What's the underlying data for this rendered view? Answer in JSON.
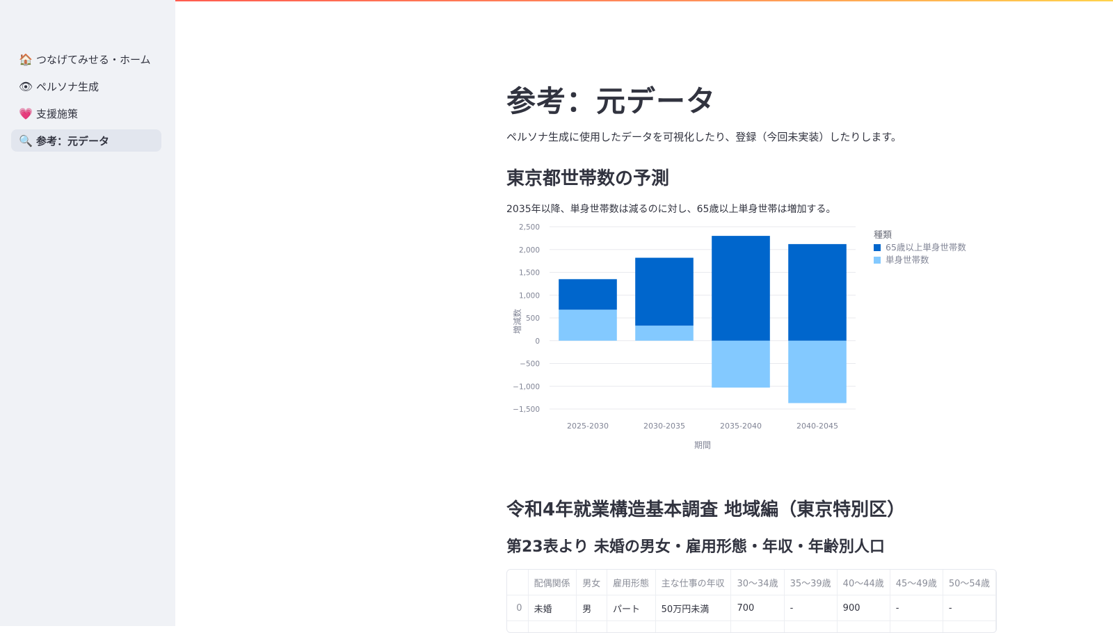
{
  "sidebar": {
    "items": [
      {
        "icon": "house-icon",
        "glyph": "🏠",
        "label": "つなげてみせる・ホーム",
        "active": false
      },
      {
        "icon": "eye-icon",
        "glyph": "👁",
        "label": "ペルソナ生成",
        "active": false
      },
      {
        "icon": "heart-icon",
        "glyph": "💗",
        "label": "支援施策",
        "active": false
      },
      {
        "icon": "magnifier-icon",
        "glyph": "🔍",
        "label": "参考：元データ",
        "active": true
      }
    ]
  },
  "main": {
    "title": "参考：元データ",
    "description": "ペルソナ生成に使用したデータを可視化したり、登録（今回未実装）したりします。",
    "section1": {
      "heading": "東京都世帯数の予測",
      "caption": "2035年以降、単身世帯数は減るのに対し、65歳以上単身世帯は増加する。"
    },
    "section2": {
      "heading": "令和4年就業構造基本調査 地域編（東京特別区）",
      "subheading": "第23表より 未婚の男女・雇用形態・年収・年齢別人口",
      "table": {
        "columns": [
          "",
          "配偶関係",
          "男女",
          "雇用形態",
          "主な仕事の年収",
          "30〜34歳",
          "35〜39歳",
          "40〜44歳",
          "45〜49歳",
          "50〜54歳"
        ],
        "rows": [
          [
            "0",
            "未婚",
            "男",
            "パート",
            "50万円未満",
            "700",
            "-",
            "900",
            "-",
            "-"
          ],
          [
            "",
            "",
            "",
            "",
            "",
            "",
            "",
            "",
            "",
            ""
          ]
        ]
      }
    }
  },
  "colors": {
    "dark_series": "#0066cc",
    "light_series": "#83c9ff",
    "sidebar_bg": "#f0f2f6"
  },
  "chart_data": {
    "type": "bar",
    "stacked": true,
    "categories": [
      "2025-2030",
      "2030-2035",
      "2035-2040",
      "2040-2045"
    ],
    "series": [
      {
        "name": "単身世帯数",
        "values": [
          680,
          330,
          -1030,
          -1370
        ],
        "color": "#83c9ff"
      },
      {
        "name": "65歳以上単身世帯数",
        "values": [
          670,
          1490,
          2300,
          2120
        ],
        "color": "#0066cc"
      }
    ],
    "xlabel": "期間",
    "ylabel": "増減数",
    "ylim": [
      -1500,
      2500
    ],
    "yticks": [
      2500,
      2000,
      1500,
      1000,
      500,
      0,
      -500,
      -1000,
      -1500
    ],
    "ytick_labels": [
      "2,500",
      "2,000",
      "1,500",
      "1,000",
      "500",
      "0",
      "−500",
      "−1,000",
      "−1,500"
    ],
    "legend_title": "種類",
    "legend_entries": [
      "65歳以上単身世帯数",
      "単身世帯数"
    ],
    "legend_position": "right",
    "grid": true
  }
}
